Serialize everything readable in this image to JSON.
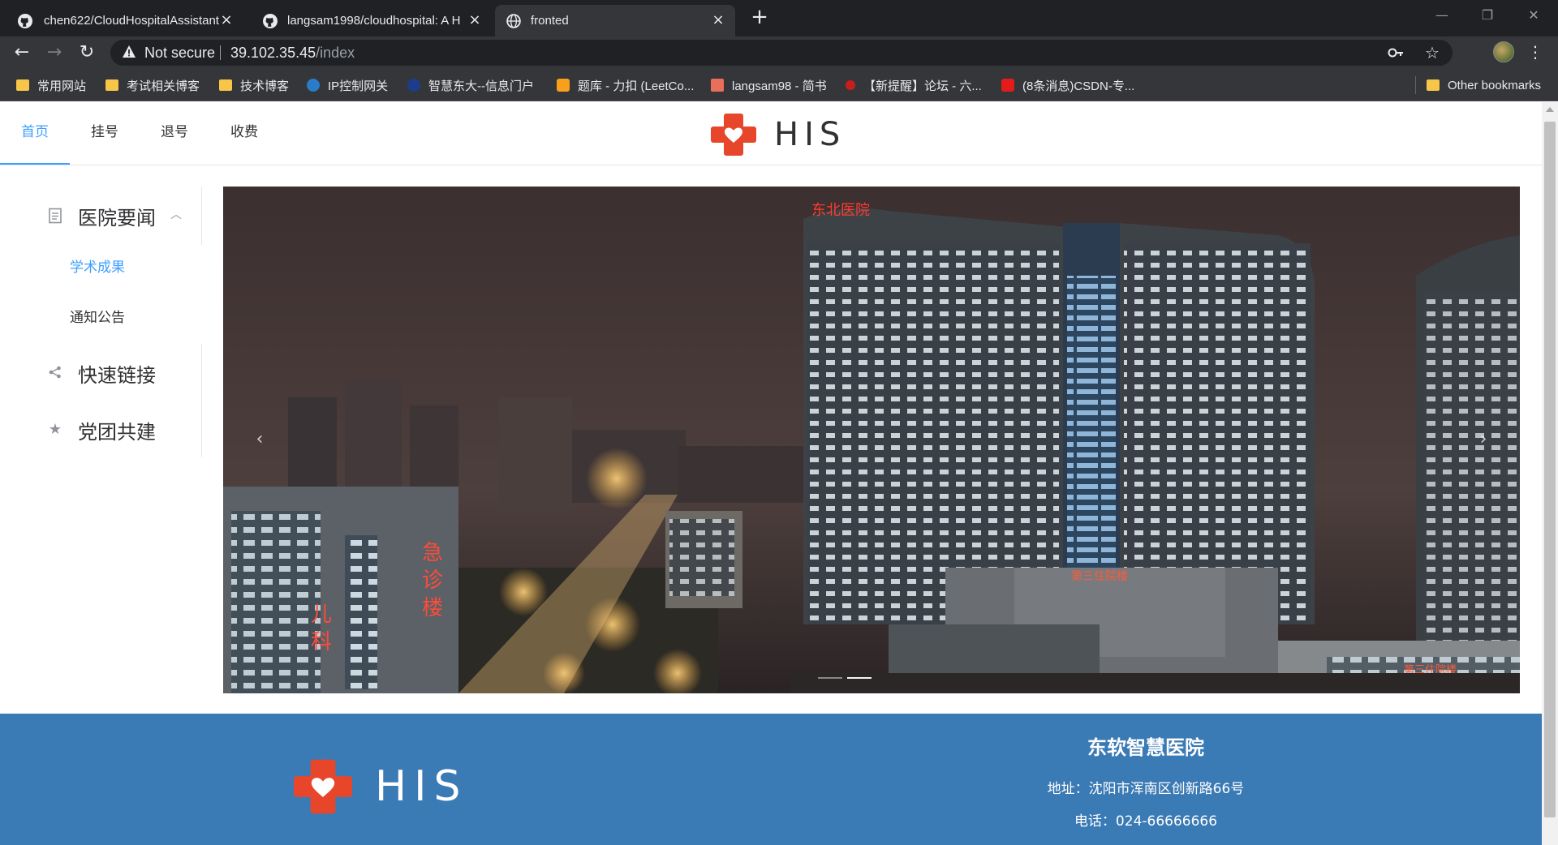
{
  "browser": {
    "tabs": [
      {
        "title": "chen622/CloudHospitalAssistant",
        "icon": "github-icon",
        "active": false
      },
      {
        "title": "langsam1998/cloudhospital: A H",
        "icon": "github-icon",
        "active": false
      },
      {
        "title": "fronted",
        "icon": "globe-icon",
        "active": true
      }
    ],
    "address": {
      "security_label": "Not secure",
      "host": "39.102.35.45",
      "path": "/index"
    },
    "bookmarks": [
      {
        "label": "常用网站",
        "icon": "folder-icon"
      },
      {
        "label": "考试相关博客",
        "icon": "folder-icon"
      },
      {
        "label": "技术博客",
        "icon": "folder-icon"
      },
      {
        "label": "IP控制网关",
        "icon": "network-gateway-icon"
      },
      {
        "label": "智慧东大--信息门户",
        "icon": "university-portal-icon"
      },
      {
        "label": "题库 - 力扣 (LeetCo...",
        "icon": "leetcode-icon"
      },
      {
        "label": "langsam98 - 简书",
        "icon": "jianshu-icon"
      },
      {
        "label": "【新提醒】论坛 - 六...",
        "icon": "forum-icon"
      },
      {
        "label": "(8条消息)CSDN-专...",
        "icon": "csdn-icon"
      }
    ],
    "other_bookmarks": "Other bookmarks"
  },
  "colors": {
    "accent": "#409eff",
    "brand_red": "#e8462b",
    "footer_bg": "#3a7ab5"
  },
  "topnav": {
    "items": [
      {
        "label": "首页",
        "active": true
      },
      {
        "label": "挂号",
        "active": false
      },
      {
        "label": "退号",
        "active": false
      },
      {
        "label": "收费",
        "active": false
      }
    ],
    "brand": "HIS"
  },
  "sidemenu": {
    "groups": [
      {
        "label": "医院要闻",
        "icon": "document-icon",
        "expanded": true,
        "children": [
          {
            "label": "学术成果",
            "active": true
          },
          {
            "label": "通知公告",
            "active": false
          }
        ]
      },
      {
        "label": "快速链接",
        "icon": "share-icon",
        "expanded": false
      },
      {
        "label": "党团共建",
        "icon": "star-icon",
        "expanded": false
      }
    ]
  },
  "carousel": {
    "image": "hospital-building-night-photo",
    "prev": "‹",
    "next": "›",
    "slide_count": 2,
    "active_slide": 2
  },
  "footer": {
    "brand": "HIS",
    "hospital_name": "东软智慧医院",
    "address": "地址：沈阳市浑南区创新路66号",
    "phone": "电话：024-66666666"
  }
}
